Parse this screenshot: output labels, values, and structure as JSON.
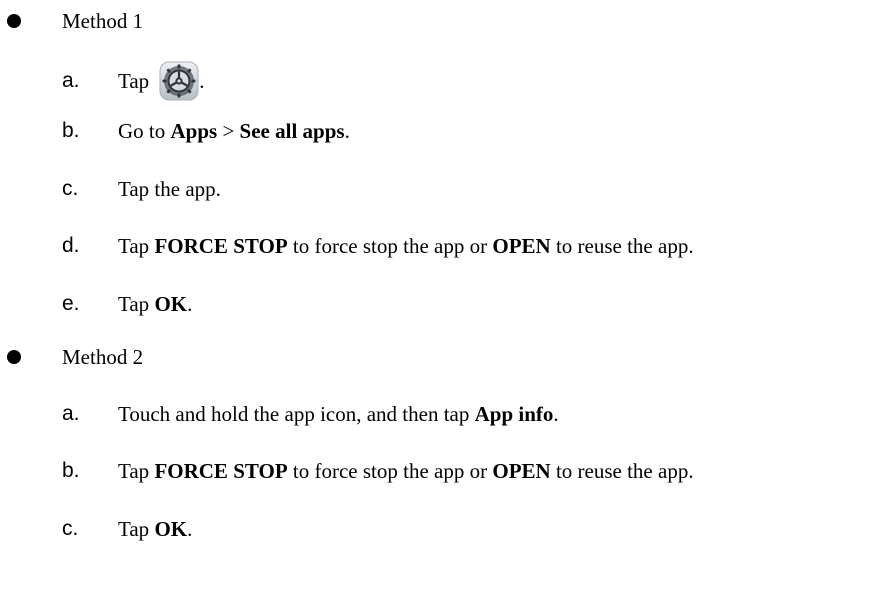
{
  "method1": {
    "label": "Method 1",
    "steps": [
      {
        "letter": "a.",
        "parts": [
          "Tap",
          "."
        ],
        "icon": "settings-gear-icon"
      },
      {
        "letter": "b.",
        "parts": [
          "Go to ",
          "Apps",
          " > ",
          "See all apps",
          "."
        ]
      },
      {
        "letter": "c.",
        "parts": [
          "Tap the app."
        ]
      },
      {
        "letter": "d.",
        "parts": [
          "Tap ",
          "FORCE STOP",
          " to force stop the app or ",
          "OPEN",
          " to reuse the app."
        ]
      },
      {
        "letter": "e.",
        "parts": [
          "Tap ",
          "OK",
          "."
        ]
      }
    ]
  },
  "method2": {
    "label": "Method 2",
    "steps": [
      {
        "letter": "a.",
        "parts": [
          "Touch and hold the app icon, and then tap ",
          "App info",
          "."
        ]
      },
      {
        "letter": "b.",
        "parts": [
          "Tap ",
          "FORCE STOP",
          " to force stop the app or ",
          "OPEN",
          " to reuse the app."
        ]
      },
      {
        "letter": "c.",
        "parts": [
          "Tap ",
          "OK",
          "."
        ]
      }
    ]
  }
}
